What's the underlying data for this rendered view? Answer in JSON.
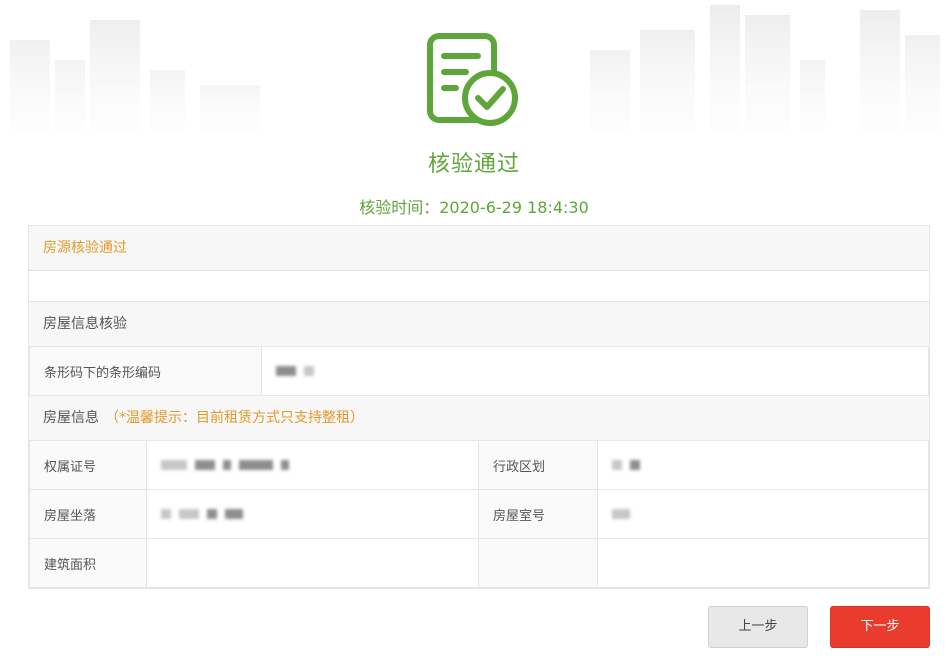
{
  "result": {
    "title": "核验通过",
    "time_text": "核验时间：2020-6-29 18:4:30"
  },
  "status_section": {
    "title": "房源核验通过"
  },
  "house_check_section": {
    "title": "房屋信息核验",
    "barcode_label": "条形码下的条形编码"
  },
  "house_info_section": {
    "title": "房屋信息",
    "tip": "（*温馨提示：目前租赁方式只支持整租）",
    "cert_no_label": "权属证号",
    "district_label": "行政区划",
    "location_label": "房屋坐落",
    "room_no_label": "房屋室号",
    "area_label": "建筑面积"
  },
  "buttons": {
    "prev_label": "上一步",
    "next_label": "下一步"
  },
  "icons": {
    "hero": "document-check-icon"
  },
  "colors": {
    "success_green": "#5fa63a",
    "tip_orange": "#e39a2a",
    "next_button_red": "#e93b2e"
  }
}
